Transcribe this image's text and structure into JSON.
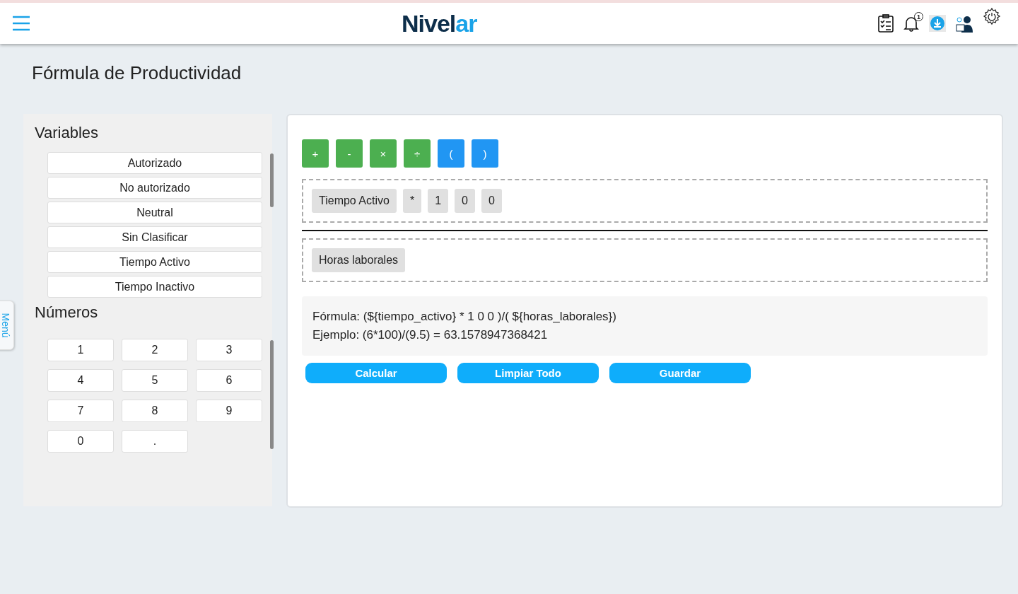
{
  "header": {
    "logo": {
      "main": "Nivel",
      "accent": "ar"
    },
    "notification_count": "1"
  },
  "side_tab": {
    "label": "Menú"
  },
  "page_title": "Fórmula de Productividad",
  "variables": {
    "title": "Variables",
    "items": [
      "Autorizado",
      "No autorizado",
      "Neutral",
      "Sin Clasificar",
      "Tiempo Activo",
      "Tiempo Inactivo"
    ]
  },
  "numbers": {
    "title": "Números",
    "items": [
      "1",
      "2",
      "3",
      "4",
      "5",
      "6",
      "7",
      "8",
      "9",
      "0",
      "."
    ]
  },
  "operators": [
    {
      "label": "+",
      "kind": "operator"
    },
    {
      "label": "-",
      "kind": "operator"
    },
    {
      "label": "×",
      "kind": "operator"
    },
    {
      "label": "÷",
      "kind": "operator"
    },
    {
      "label": "(",
      "kind": "paren"
    },
    {
      "label": ")",
      "kind": "paren"
    }
  ],
  "numerator": [
    "Tiempo Activo",
    "*",
    "1",
    "0",
    "0"
  ],
  "denominator": [
    "Horas laborales"
  ],
  "result": {
    "formula": "Fórmula: (${tiempo_activo} * 1 0 0 )/( ${horas_laborales})",
    "example": "Ejemplo: (6*100)/(9.5) = 63.1578947368421"
  },
  "actions": [
    "Calcular",
    "Limpiar Todo",
    "Guardar"
  ]
}
